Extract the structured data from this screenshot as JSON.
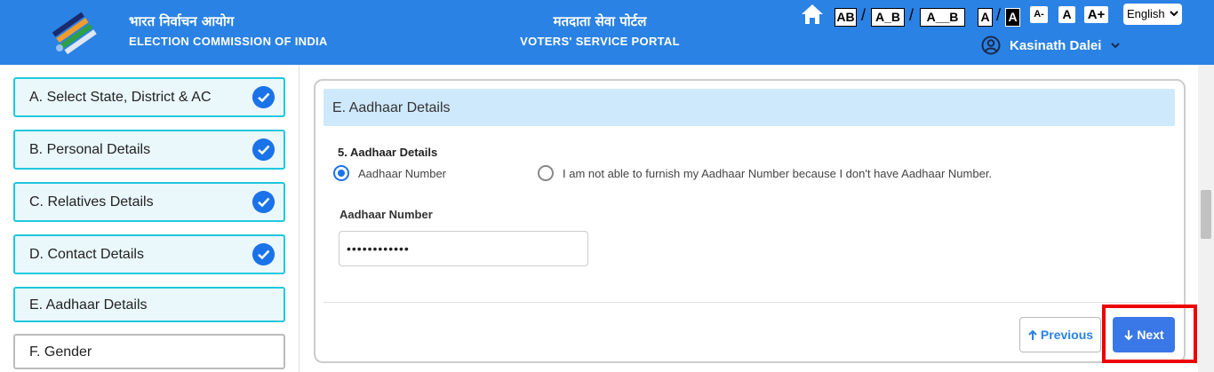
{
  "header": {
    "eci_hindi": "भारत निर्वाचन आयोग",
    "eci_english": "ELECTION COMMISSION OF INDIA",
    "portal_hindi": "मतदाता सेवा पोर्टल",
    "portal_english": "VOTERS' SERVICE PORTAL",
    "spacing_options": [
      "AB",
      "A_B",
      "A__B"
    ],
    "contrast_options": [
      "A",
      "A"
    ],
    "size_options": [
      "A-",
      "A",
      "A+"
    ],
    "language": "English",
    "user_name": "Kasinath Dalei",
    "brand_color": "#2a82e4"
  },
  "sidebar": {
    "steps": [
      {
        "label": "A. Select State, District & AC",
        "completed": true
      },
      {
        "label": "B. Personal Details",
        "completed": true
      },
      {
        "label": "C. Relatives Details",
        "completed": true
      },
      {
        "label": "D. Contact Details",
        "completed": true
      },
      {
        "label": "E. Aadhaar Details",
        "completed": false,
        "active": true
      },
      {
        "label": "F. Gender",
        "completed": false
      }
    ]
  },
  "form": {
    "section_title": "E. Aadhaar Details",
    "question_label": "5. Aadhaar Details",
    "options": [
      {
        "label": "Aadhaar Number",
        "selected": true
      },
      {
        "label": "I am not able to furnish my Aadhaar Number because I don't have Aadhaar Number.",
        "selected": false
      }
    ],
    "field_label": "Aadhaar Number",
    "field_value": "••••••••••••",
    "previous_label": "Previous",
    "next_label": "Next"
  }
}
